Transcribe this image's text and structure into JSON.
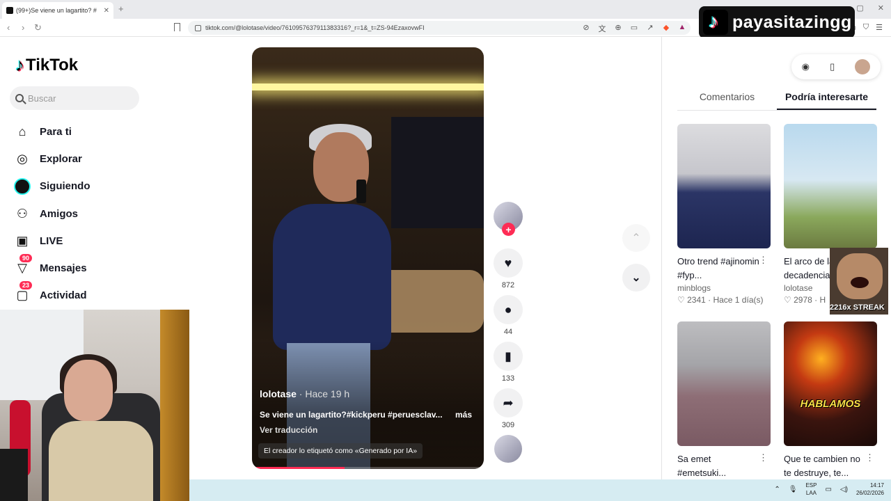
{
  "browser": {
    "tab_title": "(99+)Se viene un lagartito? #",
    "url": "tiktok.com/@lolotase/video/7610957637911383316?_r=1&_t=ZS-94EzaxovwFI"
  },
  "streamer": {
    "name": "payasitazingg"
  },
  "tiktok": {
    "logo_text": "TikTok",
    "search_placeholder": "Buscar",
    "nav": [
      {
        "label": "Para ti",
        "icon": "home-icon"
      },
      {
        "label": "Explorar",
        "icon": "compass-icon"
      },
      {
        "label": "Siguiendo",
        "icon": "following-avatar-icon"
      },
      {
        "label": "Amigos",
        "icon": "friends-icon"
      },
      {
        "label": "LIVE",
        "icon": "live-icon"
      },
      {
        "label": "Mensajes",
        "icon": "messages-icon",
        "badge": "90"
      },
      {
        "label": "Actividad",
        "icon": "activity-icon",
        "badge": "23"
      }
    ]
  },
  "video": {
    "author": "lolotase",
    "time": " · Hace 19 h",
    "caption": "Se viene un lagartito?#kickperu #peruesclav...",
    "more": "más",
    "translate": "Ver traducción",
    "ai_tag": "El creador lo etiquetó como «Generado por IA»",
    "progress": 0.4
  },
  "actions": {
    "likes": "872",
    "comments": "44",
    "saves": "133",
    "shares": "309"
  },
  "right_panel": {
    "tabs": [
      "Comentarios",
      "Podría interesarte"
    ],
    "active_tab": "Podría interesarte",
    "cards": [
      {
        "title": "Otro trend #ajinomin #fyp...",
        "author": "minblogs",
        "meta": "♡ 2341  ·  Hace 1 día(s)"
      },
      {
        "title": "El arco de la decadencia...",
        "author": "lolotase",
        "meta": "♡ 2978  ·  H"
      },
      {
        "title": "Sa emet #emetsuki...",
        "author": "",
        "meta": ""
      },
      {
        "title": "Que te cambien no te destruye, te...",
        "author": "",
        "meta": "",
        "overlay": "HABLAMOS"
      }
    ],
    "streak_text": "2216x STREAK"
  },
  "taskbar": {
    "lang_line1": "ESP",
    "lang_line2": "LAA",
    "time": "14:17",
    "date": "26/02/2026"
  },
  "colors": {
    "brand_pink": "#fe2c55",
    "brand_cyan": "#25f4ee",
    "taskbar": "#d6ecf2"
  }
}
